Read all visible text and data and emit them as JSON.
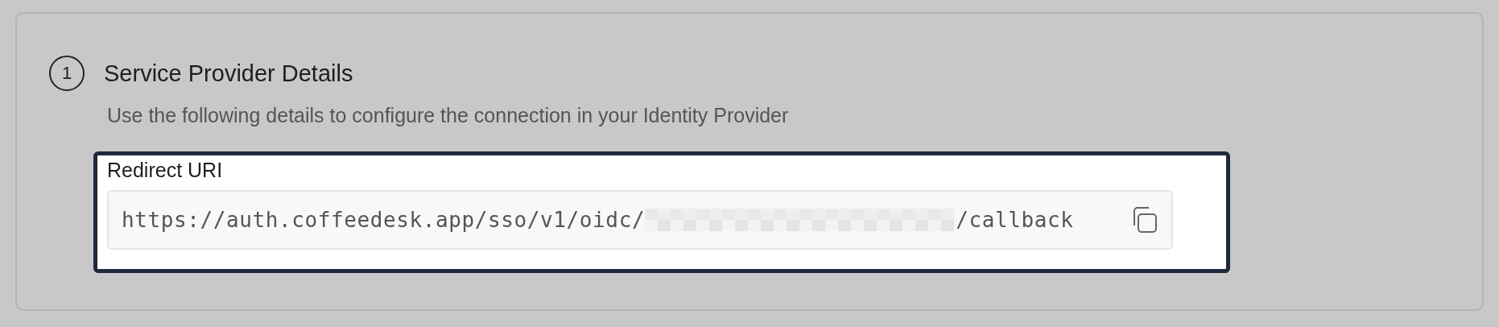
{
  "section": {
    "step": "1",
    "title": "Service Provider Details",
    "description": "Use the following details to configure the connection in your Identity Provider"
  },
  "field": {
    "label": "Redirect URI",
    "value_start": "https://auth.coffeedesk.app/sso/v1/oidc/",
    "value_end": "/callback",
    "highlighted": true
  }
}
